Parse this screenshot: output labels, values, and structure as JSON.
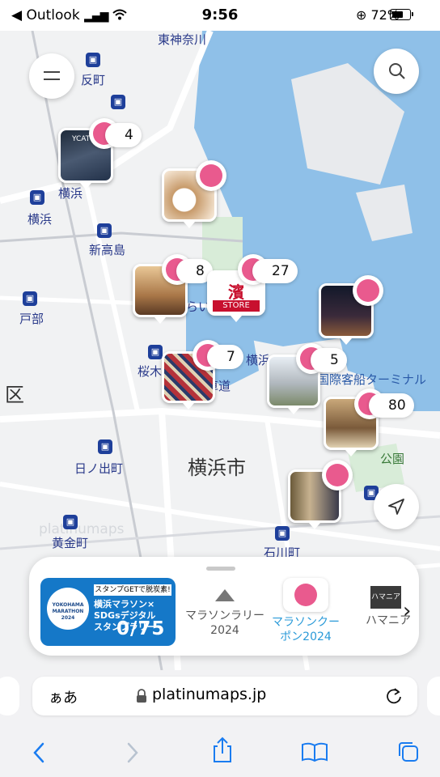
{
  "status_bar": {
    "back_app": "◀ Outlook",
    "time": "9:56",
    "battery": "72%",
    "battery_level": 0.72
  },
  "map": {
    "labels": {
      "higashi_kanagawa": "東神奈川",
      "tanmachi": "反町",
      "yokohama": "横浜",
      "yokohama2": "横浜",
      "shin_takashima": "新高島",
      "tobe": "戸部",
      "ku": "区",
      "sakuragi": "桜木",
      "bashamichi": "馬車道",
      "hinodecho": "日ノ出町",
      "yokohama_city": "横浜市",
      "koganecho": "黄金町",
      "ishikawacho": "石川町",
      "terminal": "国際客船ターミナル",
      "yokohama_small": "横浜",
      "park": "公園",
      "mm": "らい",
      "watermark": "platinumaps",
      "ycat": "YCAT Lo"
    },
    "pins": [
      {
        "name": "pin-ycat",
        "count": "4"
      },
      {
        "name": "pin-cafe",
        "count": ""
      },
      {
        "name": "pin-shop",
        "count": "8"
      },
      {
        "name": "pin-store",
        "count": "27",
        "store_logo": "濱",
        "store_text": "STORE"
      },
      {
        "name": "pin-night",
        "count": ""
      },
      {
        "name": "pin-bag",
        "count": "7"
      },
      {
        "name": "pin-building",
        "count": "5"
      },
      {
        "name": "pin-hall",
        "count": "80"
      },
      {
        "name": "pin-interior",
        "count": ""
      }
    ]
  },
  "sheet": {
    "banner": {
      "tag": "スタンプGETで脱炭素!",
      "line1": "横浜マラソン×",
      "line2": "SDGsデジタル",
      "line3": "スタンプラリー",
      "counter": "0/75",
      "logo_text": "YOKOHAMA MARATHON 2024"
    },
    "tabs": [
      {
        "line1": "マラソンラリー",
        "line2": "2024"
      },
      {
        "line1": "マラソンクー",
        "line2": "ポン2024"
      },
      {
        "line1": "ハマニア",
        "logo": "ハマニア"
      }
    ]
  },
  "address_bar": {
    "aa": "ぁあ",
    "url": "platinumaps.jp"
  },
  "colors": {
    "water": "#8fc0e8",
    "accent": "#2a9ad8",
    "station": "#1e3f9a",
    "banner": "#1578c8",
    "badge": "#e95a8e"
  }
}
